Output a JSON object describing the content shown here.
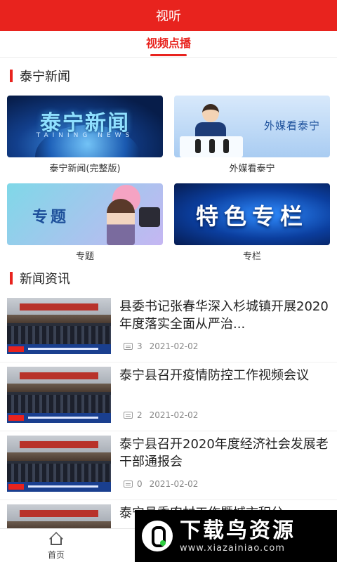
{
  "header": {
    "title": "视听"
  },
  "tabs": [
    {
      "label": "视频点播",
      "active": true
    }
  ],
  "sections": {
    "video": {
      "title": "泰宁新闻",
      "cards": [
        {
          "label": "泰宁新闻(完整版)",
          "thumb_text": "泰宁新闻",
          "thumb_sub": "TAINING NEWS"
        },
        {
          "label": "外媒看泰宁",
          "thumb_text": "外媒看泰宁"
        },
        {
          "label": "专题",
          "thumb_text": "专题"
        },
        {
          "label": "专栏",
          "thumb_text": "特色专栏"
        }
      ]
    },
    "news": {
      "title": "新闻资讯",
      "items": [
        {
          "title": "县委书记张春华深入杉城镇开展2020年度落实全面从严治...",
          "comments": "3",
          "date": "2021-02-02"
        },
        {
          "title": "泰宁县召开疫情防控工作视频会议",
          "comments": "2",
          "date": "2021-02-02"
        },
        {
          "title": "泰宁县召开2020年度经济社会发展老干部通报会",
          "comments": "0",
          "date": "2021-02-02"
        },
        {
          "title": "泰宁县委农村工作暨城市积分...",
          "comments": "",
          "date": ""
        }
      ]
    }
  },
  "bottom_nav": {
    "home_label": "首页"
  },
  "watermark": {
    "main": "下载鸟资源",
    "url": "www.xiazainiao.com"
  },
  "colors": {
    "brand": "#e8231e"
  }
}
